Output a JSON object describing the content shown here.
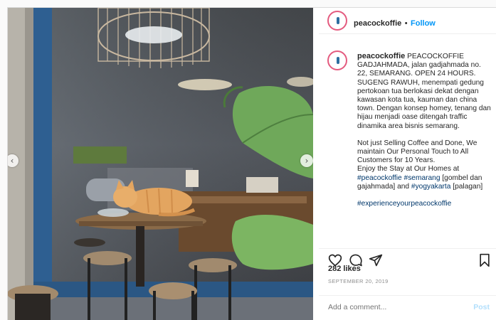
{
  "post": {
    "username": "peacockoffie",
    "follow_label": "Follow",
    "separator": "•",
    "caption": {
      "username": "peacockoffie",
      "para1": "PEACOCKOFFIE GADJAHMADA, jalan gadjahmada no. 22, SEMARANG. OPEN 24 HOURS. SUGENG RAWUH, menempati gedung pertokoan tua berlokasi dekat dengan kawasan kota tua, kauman dan china town. Dengan konsep homey, tenang dan hijau menjadi oase ditengah traffic dinamika area bisnis semarang.",
      "para2": "Not just Selling Coffee and Done, We maintain Our Personal Touch to All Customers for 10 Years.",
      "para3_prefix": "Enjoy the Stay at Our Homes at",
      "tag_peacockoffie": "#peacockoffie",
      "tag_semarang": "#semarang",
      "text_gombel": "[gombel dan gajahmada] and",
      "tag_yogyakarta": "#yogyakarta",
      "text_palagan": "[palagan]",
      "tag_experience": "#experienceyourpeacockoffie"
    },
    "likes": "282 likes",
    "date": "SEPTEMBER 20, 2019",
    "comment_placeholder": "Add a comment...",
    "post_label": "Post",
    "nav_prev": "‹",
    "nav_next": "›"
  },
  "icons": {
    "like": "heart-icon",
    "comment": "comment-icon",
    "share": "share-icon",
    "save": "bookmark-icon"
  },
  "colors": {
    "link": "#0095f6",
    "hashtag": "#00376b",
    "text": "#262626",
    "muted": "#8e8e8e",
    "ring": "#e45b7f"
  }
}
